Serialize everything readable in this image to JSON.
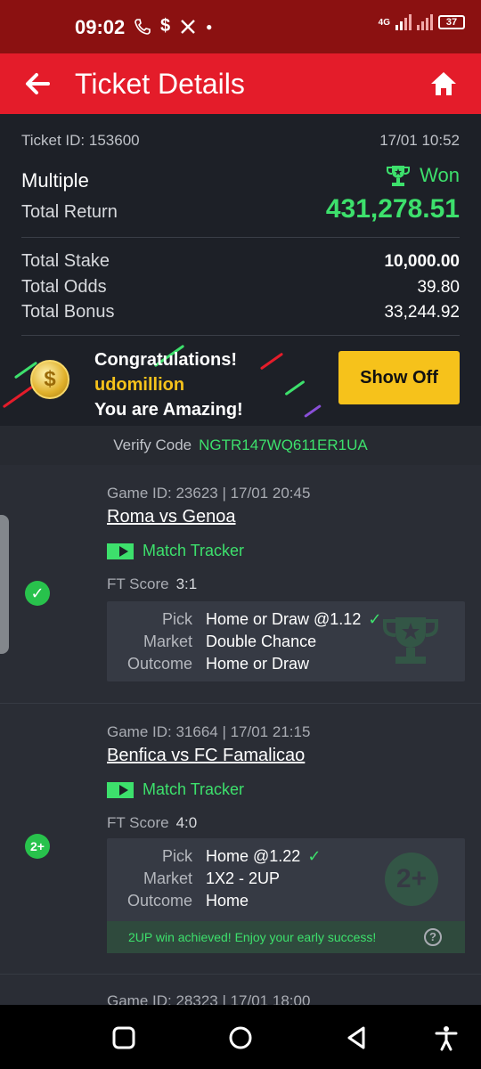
{
  "status_bar": {
    "time": "09:02",
    "icons": [
      "phone-icon",
      "s-app-icon",
      "x-icon",
      "dot-icon"
    ],
    "network": "4G",
    "battery": "37"
  },
  "app_bar": {
    "title": "Ticket Details",
    "back_icon": "arrow-left-icon",
    "home_icon": "home-icon"
  },
  "ticket": {
    "id_label": "Ticket ID: 153600",
    "date": "17/01 10:52",
    "type": "Multiple",
    "status": "Won",
    "total_return_label": "Total Return",
    "total_return": "431,278.51",
    "total_stake_label": "Total Stake",
    "total_stake": "10,000.00",
    "total_odds_label": "Total Odds",
    "total_odds": "39.80",
    "total_bonus_label": "Total Bonus",
    "total_bonus": "33,244.92"
  },
  "banner": {
    "line1": "Congratulations!",
    "username": "udomillion",
    "line3": "You are Amazing!",
    "button": "Show Off"
  },
  "verify": {
    "label": "Verify Code",
    "code": "NGTR147WQ611ER1UA"
  },
  "games": [
    {
      "id_line": "Game ID: 23623 | 17/01 20:45",
      "teams": "Roma vs Genoa",
      "tracker": "Match Tracker",
      "ft_label": "FT Score",
      "ft_score": "3:1",
      "pick_label": "Pick",
      "pick": "Home or Draw @1.12",
      "market_label": "Market",
      "market": "Double Chance",
      "outcome_label": "Outcome",
      "outcome": "Home or Draw"
    },
    {
      "id_line": "Game ID: 31664 | 17/01 21:15",
      "teams": "Benfica vs FC Famalicao",
      "tracker": "Match Tracker",
      "ft_label": "FT Score",
      "ft_score": "4:0",
      "pick_label": "Pick",
      "pick": "Home @1.22",
      "market_label": "Market",
      "market": "1X2 - 2UP",
      "outcome_label": "Outcome",
      "outcome": "Home",
      "badge": "2+",
      "note": "2UP win achieved! Enjoy your early success!"
    },
    {
      "id_line": "Game ID: 28323 | 17/01 18:00"
    }
  ],
  "colors": {
    "accent_red": "#e41c2a",
    "win_green": "#3de06c",
    "button_yellow": "#f6c21b"
  }
}
